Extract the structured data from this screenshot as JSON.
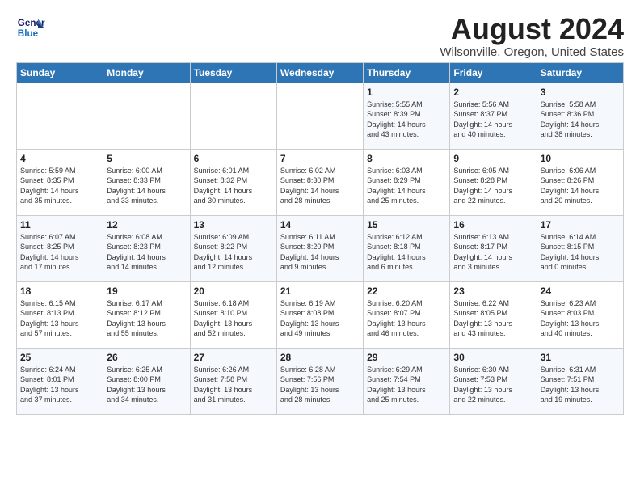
{
  "header": {
    "logo_line1": "General",
    "logo_line2": "Blue",
    "month": "August 2024",
    "location": "Wilsonville, Oregon, United States"
  },
  "days_of_week": [
    "Sunday",
    "Monday",
    "Tuesday",
    "Wednesday",
    "Thursday",
    "Friday",
    "Saturday"
  ],
  "weeks": [
    [
      {
        "day": "",
        "info": ""
      },
      {
        "day": "",
        "info": ""
      },
      {
        "day": "",
        "info": ""
      },
      {
        "day": "",
        "info": ""
      },
      {
        "day": "1",
        "info": "Sunrise: 5:55 AM\nSunset: 8:39 PM\nDaylight: 14 hours\nand 43 minutes."
      },
      {
        "day": "2",
        "info": "Sunrise: 5:56 AM\nSunset: 8:37 PM\nDaylight: 14 hours\nand 40 minutes."
      },
      {
        "day": "3",
        "info": "Sunrise: 5:58 AM\nSunset: 8:36 PM\nDaylight: 14 hours\nand 38 minutes."
      }
    ],
    [
      {
        "day": "4",
        "info": "Sunrise: 5:59 AM\nSunset: 8:35 PM\nDaylight: 14 hours\nand 35 minutes."
      },
      {
        "day": "5",
        "info": "Sunrise: 6:00 AM\nSunset: 8:33 PM\nDaylight: 14 hours\nand 33 minutes."
      },
      {
        "day": "6",
        "info": "Sunrise: 6:01 AM\nSunset: 8:32 PM\nDaylight: 14 hours\nand 30 minutes."
      },
      {
        "day": "7",
        "info": "Sunrise: 6:02 AM\nSunset: 8:30 PM\nDaylight: 14 hours\nand 28 minutes."
      },
      {
        "day": "8",
        "info": "Sunrise: 6:03 AM\nSunset: 8:29 PM\nDaylight: 14 hours\nand 25 minutes."
      },
      {
        "day": "9",
        "info": "Sunrise: 6:05 AM\nSunset: 8:28 PM\nDaylight: 14 hours\nand 22 minutes."
      },
      {
        "day": "10",
        "info": "Sunrise: 6:06 AM\nSunset: 8:26 PM\nDaylight: 14 hours\nand 20 minutes."
      }
    ],
    [
      {
        "day": "11",
        "info": "Sunrise: 6:07 AM\nSunset: 8:25 PM\nDaylight: 14 hours\nand 17 minutes."
      },
      {
        "day": "12",
        "info": "Sunrise: 6:08 AM\nSunset: 8:23 PM\nDaylight: 14 hours\nand 14 minutes."
      },
      {
        "day": "13",
        "info": "Sunrise: 6:09 AM\nSunset: 8:22 PM\nDaylight: 14 hours\nand 12 minutes."
      },
      {
        "day": "14",
        "info": "Sunrise: 6:11 AM\nSunset: 8:20 PM\nDaylight: 14 hours\nand 9 minutes."
      },
      {
        "day": "15",
        "info": "Sunrise: 6:12 AM\nSunset: 8:18 PM\nDaylight: 14 hours\nand 6 minutes."
      },
      {
        "day": "16",
        "info": "Sunrise: 6:13 AM\nSunset: 8:17 PM\nDaylight: 14 hours\nand 3 minutes."
      },
      {
        "day": "17",
        "info": "Sunrise: 6:14 AM\nSunset: 8:15 PM\nDaylight: 14 hours\nand 0 minutes."
      }
    ],
    [
      {
        "day": "18",
        "info": "Sunrise: 6:15 AM\nSunset: 8:13 PM\nDaylight: 13 hours\nand 57 minutes."
      },
      {
        "day": "19",
        "info": "Sunrise: 6:17 AM\nSunset: 8:12 PM\nDaylight: 13 hours\nand 55 minutes."
      },
      {
        "day": "20",
        "info": "Sunrise: 6:18 AM\nSunset: 8:10 PM\nDaylight: 13 hours\nand 52 minutes."
      },
      {
        "day": "21",
        "info": "Sunrise: 6:19 AM\nSunset: 8:08 PM\nDaylight: 13 hours\nand 49 minutes."
      },
      {
        "day": "22",
        "info": "Sunrise: 6:20 AM\nSunset: 8:07 PM\nDaylight: 13 hours\nand 46 minutes."
      },
      {
        "day": "23",
        "info": "Sunrise: 6:22 AM\nSunset: 8:05 PM\nDaylight: 13 hours\nand 43 minutes."
      },
      {
        "day": "24",
        "info": "Sunrise: 6:23 AM\nSunset: 8:03 PM\nDaylight: 13 hours\nand 40 minutes."
      }
    ],
    [
      {
        "day": "25",
        "info": "Sunrise: 6:24 AM\nSunset: 8:01 PM\nDaylight: 13 hours\nand 37 minutes."
      },
      {
        "day": "26",
        "info": "Sunrise: 6:25 AM\nSunset: 8:00 PM\nDaylight: 13 hours\nand 34 minutes."
      },
      {
        "day": "27",
        "info": "Sunrise: 6:26 AM\nSunset: 7:58 PM\nDaylight: 13 hours\nand 31 minutes."
      },
      {
        "day": "28",
        "info": "Sunrise: 6:28 AM\nSunset: 7:56 PM\nDaylight: 13 hours\nand 28 minutes."
      },
      {
        "day": "29",
        "info": "Sunrise: 6:29 AM\nSunset: 7:54 PM\nDaylight: 13 hours\nand 25 minutes."
      },
      {
        "day": "30",
        "info": "Sunrise: 6:30 AM\nSunset: 7:53 PM\nDaylight: 13 hours\nand 22 minutes."
      },
      {
        "day": "31",
        "info": "Sunrise: 6:31 AM\nSunset: 7:51 PM\nDaylight: 13 hours\nand 19 minutes."
      }
    ]
  ]
}
